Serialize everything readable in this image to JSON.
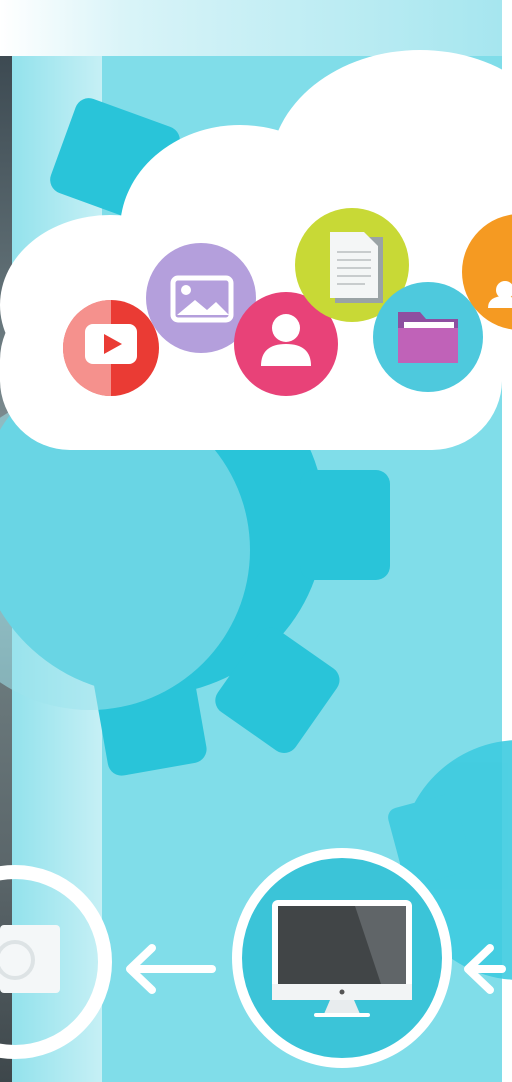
{
  "scene": {
    "description_elements": [
      "cloud",
      "gears",
      "app-icons",
      "monitor",
      "arrows",
      "photo-strip"
    ],
    "colors": {
      "background_sky": "#7fdce9",
      "gear": "#28c4d9",
      "cloud": "#ffffff",
      "youtube_red": "#ea3b34",
      "image_purple": "#b49fdc",
      "user_pink": "#e84278",
      "doc_green": "#c8d936",
      "folder_teal": "#4ec9dd",
      "orange": "#f59a22",
      "monitor_ring": "#ffffff",
      "monitor_fill": "#3cc3d8"
    },
    "icons": [
      "youtube-play-icon",
      "image-icon",
      "user-icon",
      "document-icon",
      "folder-icon",
      "user-icon-partial",
      "desktop-monitor-icon",
      "camera-icon",
      "arrow-left-icon"
    ]
  }
}
